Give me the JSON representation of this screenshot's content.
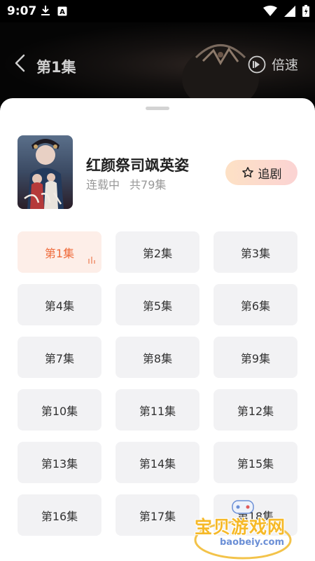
{
  "status_bar": {
    "time": "9:07",
    "left_icons": [
      "download-icon",
      "keyboard-a-icon"
    ],
    "right_icons": [
      "wifi-icon",
      "signal-icon",
      "battery-icon"
    ]
  },
  "nav": {
    "back_icon": "chevron-left-icon",
    "title": "第1集",
    "speed_icon": "speed-play-icon",
    "speed_label": "倍速"
  },
  "drama": {
    "title": "红颜祭司飒英姿",
    "status": "连载中",
    "total": "共79集",
    "follow_label": "追剧",
    "follow_icon": "star-outline-icon"
  },
  "episodes": [
    "第1集",
    "第2集",
    "第3集",
    "第4集",
    "第5集",
    "第6集",
    "第7集",
    "第8集",
    "第9集",
    "第10集",
    "第11集",
    "第12集",
    "第13集",
    "第14集",
    "第15集",
    "第16集",
    "第17集",
    "第18集"
  ],
  "active_episode_index": 0,
  "watermark": {
    "text": "宝贝游戏网",
    "url": "baobeiy.com"
  },
  "colors": {
    "accent": "#ef6a3a",
    "active_bg": "#fdeee8",
    "tile_bg": "#f2f2f4",
    "follow_gradient_start": "#fde1c5",
    "follow_gradient_end": "#fbd3d3"
  }
}
